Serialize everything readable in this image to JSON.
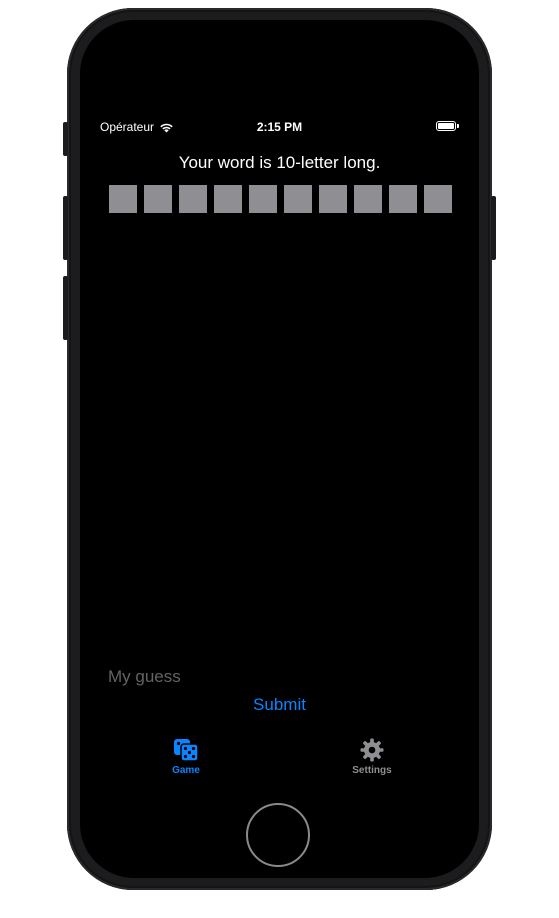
{
  "status_bar": {
    "carrier": "Opérateur",
    "time": "2:15 PM",
    "wifi_icon": "wifi-icon",
    "battery_icon": "battery-icon"
  },
  "game": {
    "headline": "Your word is 10-letter long.",
    "letter_count": 10,
    "tile_color": "#8e8e93"
  },
  "guess": {
    "placeholder": "My guess",
    "value": ""
  },
  "submit_label": "Submit",
  "tab_bar": {
    "active_color": "#0a84ff",
    "inactive_color": "#8e8e93",
    "tabs": [
      {
        "label": "Game",
        "icon": "dice-icon",
        "active": true
      },
      {
        "label": "Settings",
        "icon": "gear-icon",
        "active": false
      }
    ]
  }
}
